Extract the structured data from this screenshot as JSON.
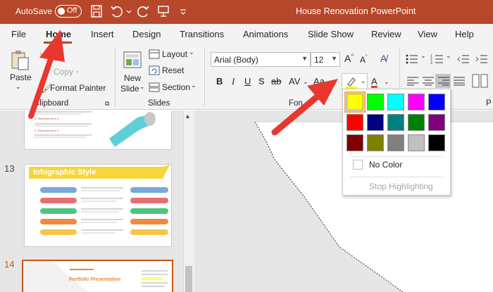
{
  "titlebar": {
    "autosave_label": "AutoSave",
    "toggle_state": "Off",
    "document_title": "House Renovation PowerPoint",
    "color": "#b7472a"
  },
  "tabs": [
    {
      "label": "File"
    },
    {
      "label": "Home"
    },
    {
      "label": "Insert"
    },
    {
      "label": "Design"
    },
    {
      "label": "Transitions"
    },
    {
      "label": "Animations"
    },
    {
      "label": "Slide Show"
    },
    {
      "label": "Review"
    },
    {
      "label": "View"
    },
    {
      "label": "Help"
    }
  ],
  "active_tab": "Home",
  "ribbon": {
    "clipboard": {
      "paste": "Paste",
      "copy": "Copy",
      "format_painter": "Format Painter",
      "label": "Clipboard"
    },
    "slides": {
      "new_slide_1": "New",
      "new_slide_2": "Slide",
      "layout": "Layout",
      "reset": "Reset",
      "section": "Section",
      "label": "Slides"
    },
    "font": {
      "font_name": "Arial (Body)",
      "font_size": "12",
      "label": "Fon"
    },
    "paragraph": {
      "label": "P"
    }
  },
  "slide_panel": {
    "slides": [
      {
        "number": "13",
        "title": "Infographic Style"
      },
      {
        "number": "14",
        "title": "Portfolio Presentation"
      }
    ],
    "slide_12_items": [
      "3. Electronic Item 3",
      "4. Electronic Item 4"
    ],
    "selected_number_color": "#c55a11"
  },
  "highlight_menu": {
    "colors": [
      [
        "#ffff00",
        "#00ff00",
        "#00ffff",
        "#ff00ff",
        "#0000ff"
      ],
      [
        "#ff0000",
        "#000080",
        "#008080",
        "#008000",
        "#800080"
      ],
      [
        "#800000",
        "#808000",
        "#808080",
        "#c0c0c0",
        "#000000"
      ]
    ],
    "no_color": "No Color",
    "stop_highlighting": "Stop Highlighting"
  },
  "annotation_color": "#e8372f"
}
